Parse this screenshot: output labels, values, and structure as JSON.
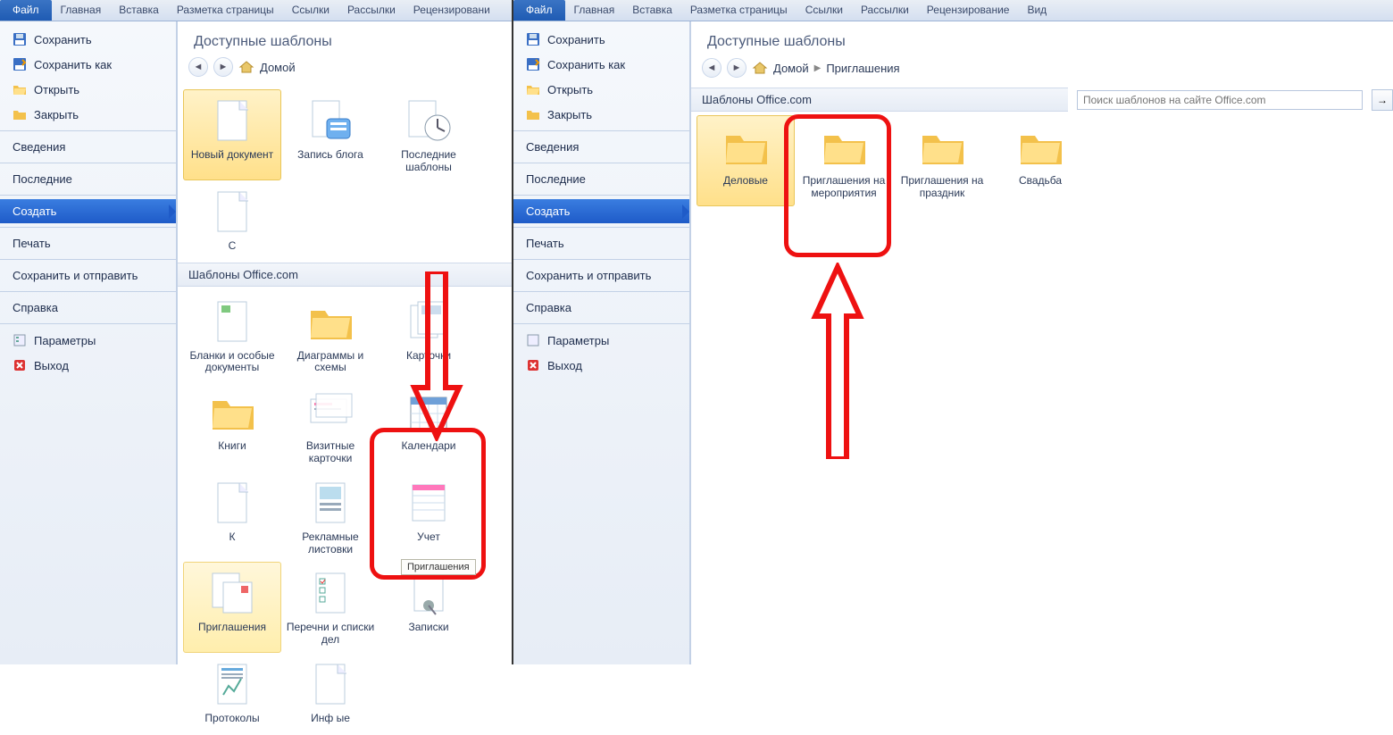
{
  "ribbon": {
    "file": "Файл",
    "tabs": [
      "Главная",
      "Вставка",
      "Разметка страницы",
      "Ссылки",
      "Рассылки",
      "Рецензировани"
    ],
    "tabs_r": [
      "Главная",
      "Вставка",
      "Разметка страницы",
      "Ссылки",
      "Рассылки",
      "Рецензирование",
      "Вид"
    ]
  },
  "side": {
    "save": "Сохранить",
    "saveas": "Сохранить как",
    "open": "Открыть",
    "close": "Закрыть",
    "info": "Сведения",
    "recent": "Последние",
    "new": "Создать",
    "print": "Печать",
    "share": "Сохранить и отправить",
    "help": "Справка",
    "options": "Параметры",
    "exit": "Выход"
  },
  "left": {
    "title": "Доступные шаблоны",
    "home": "Домой",
    "section2": "Шаблоны Office.com",
    "row1": [
      {
        "k": "newdoc",
        "label": "Новый документ",
        "sel": true,
        "icon": "page"
      },
      {
        "k": "blog",
        "label": "Запись блога",
        "icon": "blog"
      },
      {
        "k": "recenttpl",
        "label": "Последние шаблоны",
        "icon": "clockpage"
      },
      {
        "k": "cut",
        "label": "С",
        "icon": "page"
      }
    ],
    "row2": [
      {
        "k": "blanks",
        "label": "Бланки и особые документы",
        "icon": "pagegreen"
      },
      {
        "k": "diag",
        "label": "Диаграммы и схемы",
        "icon": "folder"
      },
      {
        "k": "cards",
        "label": "Карточки",
        "icon": "cardstack"
      }
    ],
    "row3": [
      {
        "k": "books",
        "label": "Книги",
        "icon": "folder"
      },
      {
        "k": "bcards",
        "label": "Визитные карточки",
        "icon": "bcard"
      },
      {
        "k": "cal",
        "label": "Календари",
        "icon": "calendar"
      },
      {
        "k": "cut2",
        "label": "К",
        "icon": "page"
      }
    ],
    "row4": [
      {
        "k": "flyers",
        "label": "Рекламные листовки",
        "icon": "flyer"
      },
      {
        "k": "acct",
        "label": "Учет",
        "icon": "ledger"
      },
      {
        "k": "inv",
        "label": "Приглашения",
        "sel": "hl",
        "icon": "invite"
      }
    ],
    "row5": [
      {
        "k": "lists",
        "label": "Перечни и списки дел",
        "icon": "checklist"
      },
      {
        "k": "notes",
        "label": "Записки",
        "icon": "pinnote"
      },
      {
        "k": "proto",
        "label": "Протоколы",
        "icon": "protocol"
      },
      {
        "k": "cut3",
        "label": "Инф ые",
        "icon": "page"
      }
    ],
    "tooltip": "Приглашения"
  },
  "right": {
    "title": "Доступные шаблоны",
    "home": "Домой",
    "crumb2": "Приглашения",
    "section": "Шаблоны Office.com",
    "search_ph": "Поиск шаблонов на сайте Office.com",
    "tiles": [
      {
        "k": "biz",
        "label": "Деловые",
        "sel": true,
        "icon": "folder"
      },
      {
        "k": "event",
        "label": "Приглашения на мероприятия",
        "icon": "folder"
      },
      {
        "k": "holiday",
        "label": "Приглашения на праздник",
        "icon": "folder"
      },
      {
        "k": "wed",
        "label": "Свадьба",
        "icon": "folder"
      }
    ]
  }
}
